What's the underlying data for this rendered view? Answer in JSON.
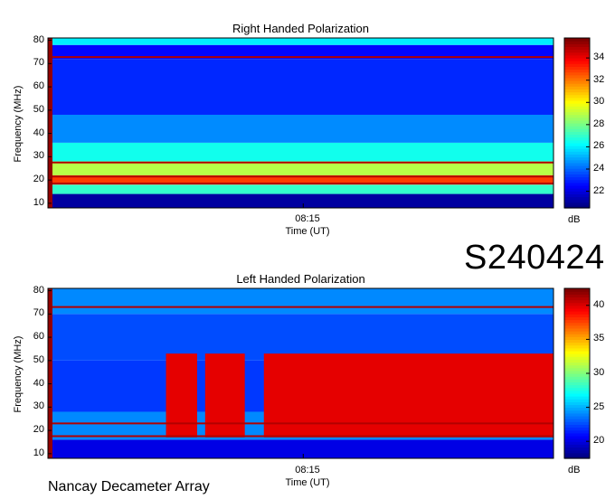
{
  "station_code": "S240424",
  "footer_label": "Nancay Decameter Array",
  "colors": {
    "colormap": [
      "#00007f",
      "#0000ff",
      "#007fff",
      "#00ffff",
      "#7fff7f",
      "#ffff00",
      "#ff7f00",
      "#ff0000",
      "#7f0000"
    ]
  },
  "chart_data": [
    {
      "type": "heatmap",
      "title": "Right Handed Polarization",
      "xlabel": "Time (UT)",
      "ylabel": "Frequency (MHz)",
      "x_ticks": [
        "08:15"
      ],
      "ylim": [
        8,
        81
      ],
      "y_ticks": [
        10,
        20,
        30,
        40,
        50,
        60,
        70,
        80
      ],
      "colorbar": {
        "label": "dB",
        "range": [
          20.5,
          35.8
        ],
        "ticks": [
          22,
          24,
          26,
          28,
          30,
          32,
          34
        ]
      },
      "bands": [
        {
          "f_min": 8,
          "f_max": 14,
          "level": 21
        },
        {
          "f_min": 14,
          "f_max": 18,
          "level": 27
        },
        {
          "f_min": 18,
          "f_max": 22,
          "level": 33
        },
        {
          "f_min": 22,
          "f_max": 28,
          "level": 29
        },
        {
          "f_min": 28,
          "f_max": 36,
          "level": 26.5
        },
        {
          "f_min": 36,
          "f_max": 48,
          "level": 24.5
        },
        {
          "f_min": 48,
          "f_max": 72,
          "level": 23
        },
        {
          "f_min": 72,
          "f_max": 78,
          "level": 22.5
        },
        {
          "f_min": 78,
          "f_max": 81,
          "level": 26
        }
      ],
      "rfi_lines_mhz": [
        18.5,
        21.5,
        27.5,
        72.8
      ]
    },
    {
      "type": "heatmap",
      "title": "Left Handed Polarization",
      "xlabel": "Time (UT)",
      "ylabel": "Frequency (MHz)",
      "x_ticks": [
        "08:15"
      ],
      "ylim": [
        8,
        81
      ],
      "y_ticks": [
        10,
        20,
        30,
        40,
        50,
        60,
        70,
        80
      ],
      "colorbar": {
        "label": "dB",
        "range": [
          17.5,
          42.5
        ],
        "ticks": [
          20,
          25,
          30,
          35,
          40
        ]
      },
      "bands": [
        {
          "f_min": 8,
          "f_max": 16,
          "level": 20
        },
        {
          "f_min": 16,
          "f_max": 28,
          "level": 24
        },
        {
          "f_min": 28,
          "f_max": 50,
          "level": 22
        },
        {
          "f_min": 50,
          "f_max": 70,
          "level": 22.5
        },
        {
          "f_min": 70,
          "f_max": 81,
          "level": 24
        }
      ],
      "strong_emission": {
        "f_min": 17,
        "f_max": 53,
        "level": 40
      },
      "emission_on_fraction": [
        [
          0.228,
          0.29
        ],
        [
          0.306,
          0.385
        ],
        [
          0.423,
          1.0
        ]
      ],
      "rfi_lines_mhz": [
        17.5,
        23,
        73
      ]
    }
  ]
}
